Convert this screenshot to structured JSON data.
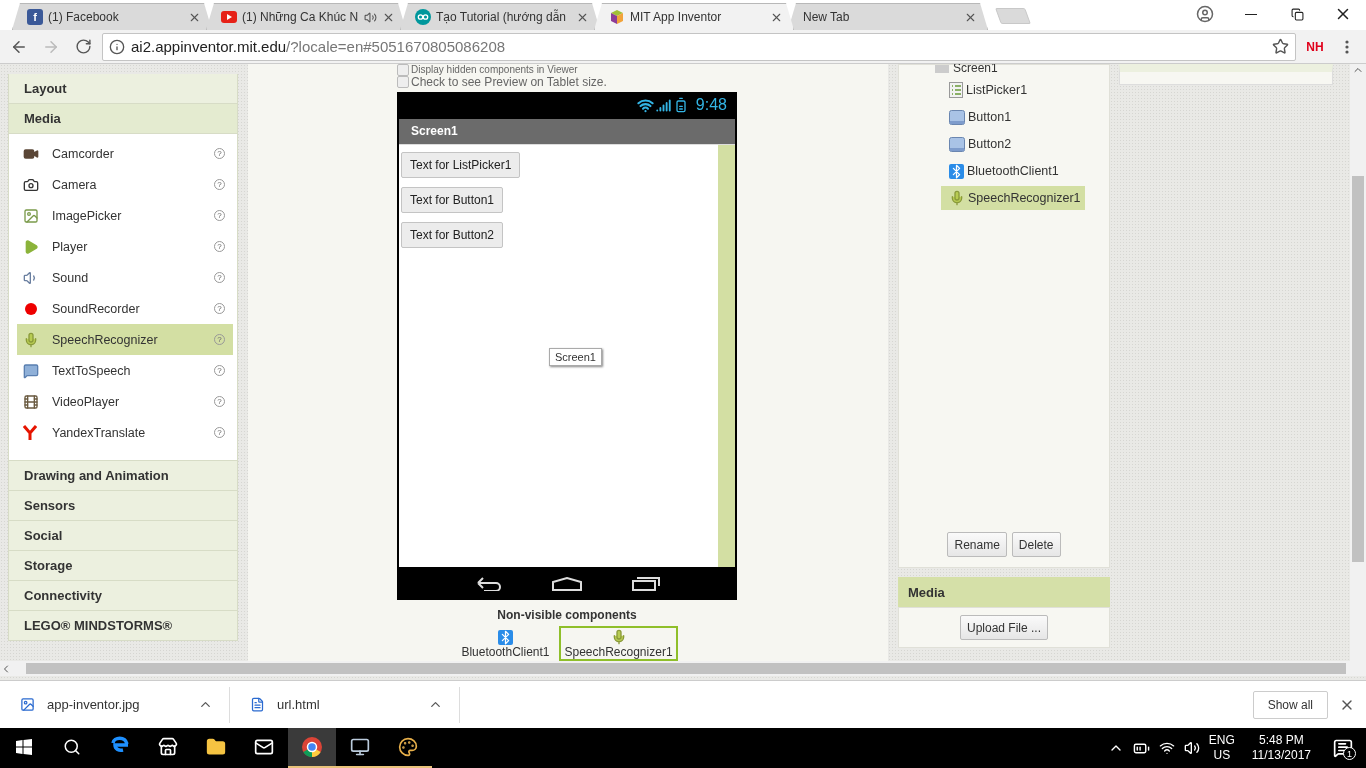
{
  "browser": {
    "tabs": [
      {
        "title": "(1) Facebook",
        "selected": false,
        "audio": false,
        "favicon_text": "f"
      },
      {
        "title": "(1) Những Ca Khúc N",
        "selected": false,
        "audio": true
      },
      {
        "title": "Tạo Tutorial (hướng dẫn",
        "selected": false,
        "audio": false
      },
      {
        "title": "MIT App Inventor",
        "selected": true,
        "audio": false
      },
      {
        "title": "New Tab",
        "selected": false,
        "audio": false
      }
    ],
    "url": {
      "host": "ai2.appinventor.mit.edu",
      "path": "/?locale=en#5051670805086208"
    },
    "extension": "NH"
  },
  "palette": {
    "categories": [
      {
        "name": "Layout",
        "expanded": false
      },
      {
        "name": "Media",
        "expanded": true,
        "items": [
          {
            "name": "Camcorder",
            "help": "?",
            "selected": false
          },
          {
            "name": "Camera",
            "help": "?",
            "selected": false
          },
          {
            "name": "ImagePicker",
            "help": "?",
            "selected": false
          },
          {
            "name": "Player",
            "help": "?",
            "selected": false
          },
          {
            "name": "Sound",
            "help": "?",
            "selected": false
          },
          {
            "name": "SoundRecorder",
            "help": "?",
            "selected": false
          },
          {
            "name": "SpeechRecognizer",
            "help": "?",
            "selected": true
          },
          {
            "name": "TextToSpeech",
            "help": "?",
            "selected": false
          },
          {
            "name": "VideoPlayer",
            "help": "?",
            "selected": false
          },
          {
            "name": "YandexTranslate",
            "help": "?",
            "selected": false
          }
        ]
      },
      {
        "name": "Drawing and Animation",
        "expanded": false
      },
      {
        "name": "Sensors",
        "expanded": false
      },
      {
        "name": "Social",
        "expanded": false
      },
      {
        "name": "Storage",
        "expanded": false
      },
      {
        "name": "Connectivity",
        "expanded": false
      },
      {
        "name": "LEGO® MINDSTORMS®",
        "expanded": false
      }
    ]
  },
  "viewer": {
    "hidden_checkbox": {
      "label": "Display hidden components in Viewer",
      "checked": false
    },
    "tablet_checkbox": {
      "label": "Check to see Preview on Tablet size.",
      "checked": false
    },
    "phone": {
      "time": "9:48",
      "title": "Screen1",
      "buttons": [
        "Text for ListPicker1",
        "Text for Button1",
        "Text for Button2"
      ],
      "tooltip": "Screen1"
    },
    "nonvisible": {
      "title": "Non-visible components",
      "items": [
        {
          "name": "BluetoothClient1",
          "kind": "bluetooth",
          "selected": false
        },
        {
          "name": "SpeechRecognizer1",
          "kind": "speech",
          "selected": true
        }
      ]
    }
  },
  "components": {
    "tree": {
      "name": "Screen1",
      "children": [
        {
          "name": "ListPicker1",
          "kind": "listpicker",
          "selected": false
        },
        {
          "name": "Button1",
          "kind": "button",
          "selected": false
        },
        {
          "name": "Button2",
          "kind": "button",
          "selected": false
        },
        {
          "name": "BluetoothClient1",
          "kind": "bluetooth",
          "selected": false
        },
        {
          "name": "SpeechRecognizer1",
          "kind": "speech",
          "selected": true
        }
      ]
    },
    "buttons": [
      "Rename",
      "Delete"
    ]
  },
  "media": {
    "title": "Media",
    "button": "Upload File ..."
  },
  "downloads": {
    "files": [
      {
        "name": "app-inventor.jpg",
        "kind": "image"
      },
      {
        "name": "url.html",
        "kind": "html"
      }
    ],
    "show_all": "Show all"
  },
  "taskbar": {
    "apps": [
      {
        "kind": "edge",
        "running": false,
        "active": false
      },
      {
        "kind": "store",
        "running": false,
        "active": false
      },
      {
        "kind": "folder",
        "running": false,
        "active": false
      },
      {
        "kind": "mail",
        "running": false,
        "active": false
      },
      {
        "kind": "chrome",
        "running": true,
        "active": true
      },
      {
        "kind": "monitor",
        "running": true,
        "active": false
      },
      {
        "kind": "paint",
        "running": true,
        "active": false
      }
    ],
    "tray": {
      "lang": "ENG",
      "region": "US",
      "time": "5:48 PM",
      "date": "11/13/2017",
      "notifications": "1"
    }
  }
}
